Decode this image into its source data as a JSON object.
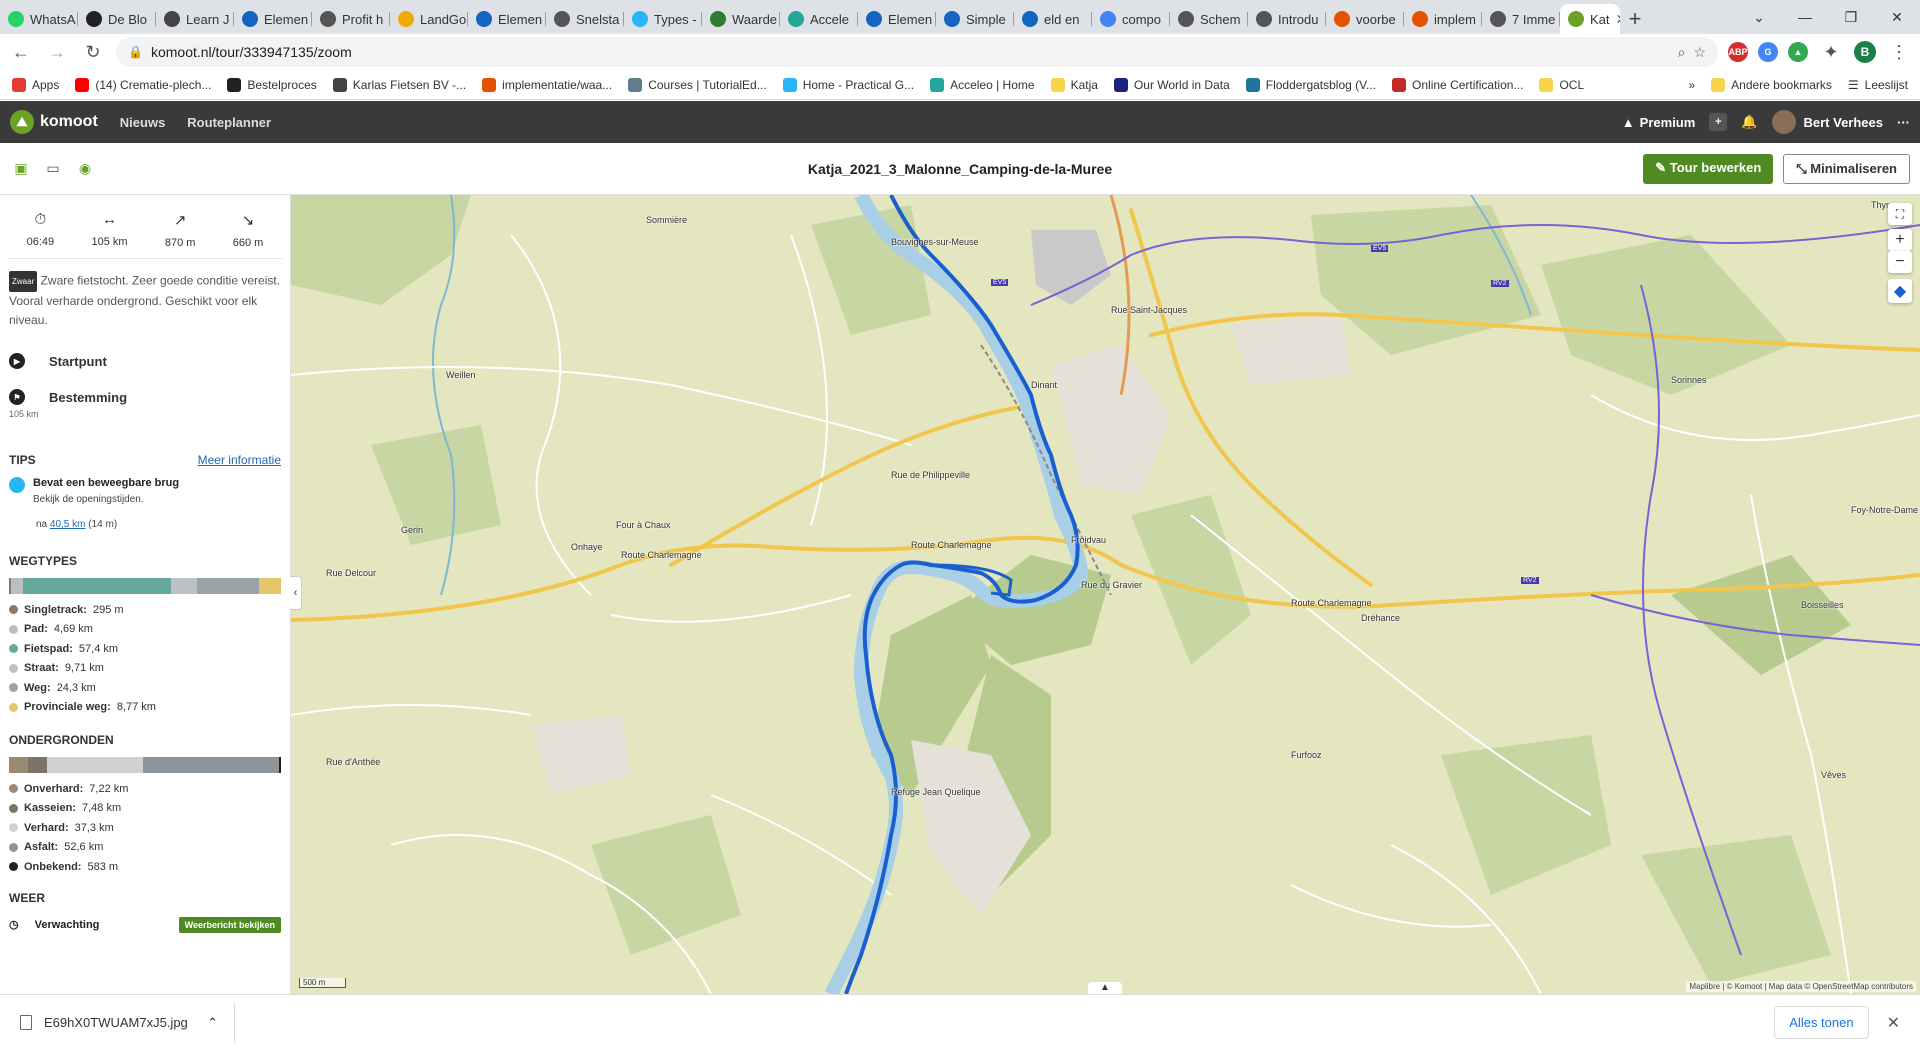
{
  "browser": {
    "tabs": [
      {
        "label": "WhatsA",
        "color": "#25d366"
      },
      {
        "label": "De Blo",
        "color": "#222222"
      },
      {
        "label": "Learn J",
        "color": "#444444"
      },
      {
        "label": "Elemen",
        "color": "#1565c0"
      },
      {
        "label": "Profit h",
        "color": "#555555"
      },
      {
        "label": "LandGo",
        "color": "#f2a900"
      },
      {
        "label": "Elemen",
        "color": "#1565c0"
      },
      {
        "label": "Snelsta",
        "color": "#555555"
      },
      {
        "label": "Types -",
        "color": "#29b6f6"
      },
      {
        "label": "Waarde",
        "color": "#2e7d32"
      },
      {
        "label": "Accele",
        "color": "#26a69a"
      },
      {
        "label": "Elemen",
        "color": "#1565c0"
      },
      {
        "label": "Simple",
        "color": "#1565c0"
      },
      {
        "label": "eld en",
        "color": "#1565c0"
      },
      {
        "label": "compo",
        "color": "#4285f4"
      },
      {
        "label": "Schem",
        "color": "#555555"
      },
      {
        "label": "Introdu",
        "color": "#555555"
      },
      {
        "label": "voorbe",
        "color": "#e65100"
      },
      {
        "label": "implem",
        "color": "#e65100"
      },
      {
        "label": "7 Imme",
        "color": "#555555"
      }
    ],
    "active_tab": {
      "label": "Kat",
      "color": "#6aa127"
    },
    "new_tab": "+",
    "url": "komoot.nl/tour/333947135/zoom",
    "profile_initial": "B",
    "bookmarks": [
      {
        "label": "Apps",
        "color": "#e53935"
      },
      {
        "label": "(14) Crematie-plech...",
        "color": "#ff0000"
      },
      {
        "label": "Bestelproces",
        "color": "#222222"
      },
      {
        "label": "Karlas Fietsen BV -...",
        "color": "#444444"
      },
      {
        "label": "implementatie/waa...",
        "color": "#e65100"
      },
      {
        "label": "Courses | TutorialEd...",
        "color": "#607d8b"
      },
      {
        "label": "Home - Practical G...",
        "color": "#29b6f6"
      },
      {
        "label": "Acceleo | Home",
        "color": "#26a69a"
      },
      {
        "label": "Katja",
        "color": "#f9d44b"
      },
      {
        "label": "Our World in Data",
        "color": "#1a237e"
      },
      {
        "label": "Floddergatsblog (V...",
        "color": "#21759b"
      },
      {
        "label": "Online Certification...",
        "color": "#c62828"
      },
      {
        "label": "OCL",
        "color": "#f9d44b"
      }
    ],
    "bookmarks_overflow": "»",
    "other_bookmarks": "Andere bookmarks",
    "reading_list": "Leeslijst"
  },
  "komoot": {
    "logo": "komoot",
    "nav": [
      "Nieuws",
      "Routeplanner"
    ],
    "premium": "Premium",
    "user": "Bert Verhees",
    "more": "···"
  },
  "tour": {
    "title": "Katja_2021_3_Malonne_Camping-de-la-Muree",
    "edit_button": "Tour bewerken",
    "minimize_button": "Minimaliseren"
  },
  "sidebar": {
    "stats": [
      {
        "icon": "stopwatch-icon",
        "glyph": "⏱",
        "value": "06:49"
      },
      {
        "icon": "distance-icon",
        "glyph": "↔",
        "value": "105 km"
      },
      {
        "icon": "ascent-icon",
        "glyph": "↗",
        "value": "870 m"
      },
      {
        "icon": "descent-icon",
        "glyph": "↘",
        "value": "660 m"
      }
    ],
    "difficulty_badge": "Zwaar",
    "description": "Zware fietstocht. Zeer goede conditie vereist. Vooral verharde ondergrond. Geschikt voor elk niveau.",
    "start_label": "Startpunt",
    "destination_label": "Bestemming",
    "destination_distance": "105 km",
    "tips_header": "TIPS",
    "tips_link": "Meer informatie",
    "tip_title": "Bevat een beweegbare brug",
    "tip_text": "Bekijk de openingstijden.",
    "tip_prefix": "na",
    "tip_distance": "40,5 km",
    "tip_elevation": "(14 m)",
    "waytypes_header": "WEGTYPES",
    "waytypes": [
      {
        "label": "Singletrack:",
        "value": "295 m",
        "color": "#8a7a62",
        "share": 0.003
      },
      {
        "label": "Pad:",
        "value": "4,69 km",
        "color": "#b9c0c2",
        "share": 0.045
      },
      {
        "label": "Fietspad:",
        "value": "57,4 km",
        "color": "#67a89d",
        "share": 0.547
      },
      {
        "label": "Straat:",
        "value": "9,71 km",
        "color": "#bcc3c6",
        "share": 0.093
      },
      {
        "label": "Weg:",
        "value": "24,3 km",
        "color": "#9aa3a8",
        "share": 0.229
      },
      {
        "label": "Provinciale weg:",
        "value": "8,77 km",
        "color": "#e3c56a",
        "share": 0.083
      }
    ],
    "surfaces_header": "ONDERGRONDEN",
    "surfaces": [
      {
        "label": "Onverhard:",
        "value": "7,22 km",
        "color": "#9b8a6f",
        "share": 0.069
      },
      {
        "label": "Kasseien:",
        "value": "7,48 km",
        "color": "#7d7466",
        "share": 0.071
      },
      {
        "label": "Verhard:",
        "value": "37,3 km",
        "color": "#cfd2d3",
        "share": 0.355
      },
      {
        "label": "Asfalt:",
        "value": "52,6 km",
        "color": "#8d959b",
        "share": 0.5
      },
      {
        "label": "Onbekend:",
        "value": "583 m",
        "color": "#222222",
        "share": 0.006
      }
    ],
    "weather_header": "WEER",
    "weather_label": "Verwachting",
    "weather_button": "Weerbericht bekijken"
  },
  "map": {
    "places": [
      "Sommière",
      "Bouvignes-sur-Meuse",
      "Rue Saint-Jacques",
      "Thynes",
      "Weillen",
      "Dinant",
      "Sorinnes",
      "Rue de Philippeville",
      "Four à Chaux",
      "Gerin",
      "Onhaye",
      "Route Charlemagne",
      "Route Charlemagne",
      "Rue Delcour",
      "Route Charlemagne",
      "Froidvau",
      "Rue du Gravier",
      "Foy-Notre-Dame",
      "Dréhance",
      "Boisseilles",
      "Rue d'Anthée",
      "Refuge Jean Quelique",
      "Furfooz",
      "Vêves"
    ],
    "route_labels": [
      "EV5",
      "EV5",
      "RV2",
      "RV2"
    ],
    "scale": "500 m",
    "attribution": "Maplibre | © Komoot | Map data © OpenStreetMap contributors",
    "zoom_in": "+",
    "zoom_out": "−"
  },
  "downloads": {
    "file": "E69hX0TWUAM7xJ5.jpg",
    "show_all": "Alles tonen"
  }
}
